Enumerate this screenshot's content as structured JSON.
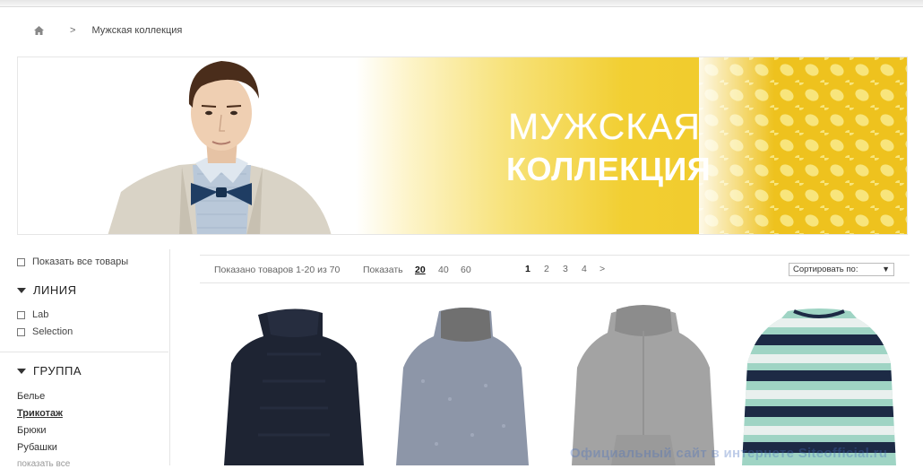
{
  "breadcrumb": {
    "home_icon": "home-icon",
    "separator": ">",
    "current": "Мужская коллекция"
  },
  "banner": {
    "title": "МУЖСКАЯ",
    "subtitle": "КОЛЛЕКЦИЯ",
    "colors": {
      "gold": "#f0c62a",
      "light": "#fdf4c9"
    }
  },
  "sidebar": {
    "show_all_label": "Показать все товары",
    "line": {
      "title": "ЛИНИЯ",
      "options": [
        "Lab",
        "Selection"
      ]
    },
    "group": {
      "title": "ГРУППА",
      "items": [
        "Белье",
        "Трикотаж",
        "Брюки",
        "Рубашки"
      ],
      "active_item": "Трикотаж",
      "more_label": "показать все"
    }
  },
  "toolbar": {
    "count_text": "Показано товаров 1-20 из 70",
    "show_label": "Показать",
    "per_page": [
      "20",
      "40",
      "60"
    ],
    "per_page_active": "20",
    "pages": [
      "1",
      "2",
      "3",
      "4",
      ">"
    ],
    "page_active": "1",
    "sort_label": "Сортировать по:",
    "sort_arrow": "▼"
  },
  "products": [
    {
      "name": "dark-navy-turtleneck",
      "color": "#1e2433"
    },
    {
      "name": "grey-melange-rollneck",
      "color": "#8d96a8"
    },
    {
      "name": "grey-hoodie",
      "color": "#a3a3a3"
    },
    {
      "name": "striped-sweater",
      "colors": [
        "#9fd4c4",
        "#1d2a45",
        "#e9f0ee"
      ]
    }
  ],
  "watermark": "Официальный сайт в интернете Siteofficial.ru"
}
